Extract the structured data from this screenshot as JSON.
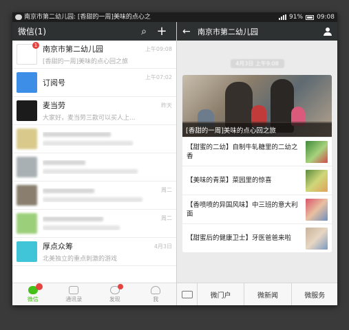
{
  "status_bar": {
    "notification": "南京市第二幼儿园: [香甜的一周]美味的点心之",
    "battery": "91%",
    "time": "09:08"
  },
  "chat_list": {
    "title": "微信(1)",
    "chats": [
      {
        "name": "南京市第二幼儿园",
        "preview": "[香甜的一周]美味的点心回之旅",
        "time": "上午09:08",
        "badge": "1",
        "avatar_color": "#ffffff"
      },
      {
        "name": "订阅号",
        "preview": "",
        "time": "上午07:02",
        "badge": "",
        "avatar_color": "#3d8ee6"
      },
      {
        "name": "麦当劳",
        "preview": "大家好，麦当劳三款可以买人上...",
        "time": "昨天",
        "badge": "",
        "avatar_color": "#1b1b1b"
      },
      {
        "name": "",
        "preview": "",
        "time": "",
        "badge": "",
        "avatar_color": "#d9c98a"
      },
      {
        "name": "",
        "preview": "",
        "time": "",
        "badge": "",
        "avatar_color": "#a9b0b3"
      },
      {
        "name": "",
        "preview": "",
        "time": "周二",
        "badge": "",
        "avatar_color": "#8a7f6e"
      },
      {
        "name": "",
        "preview": "",
        "time": "周二",
        "badge": "",
        "avatar_color": "#9ccf7a"
      },
      {
        "name": "厚点众筹",
        "preview": "北美独立的重点刺激的游戏",
        "time": "4月3日",
        "badge": "",
        "avatar_color": "#3fc4d8"
      }
    ],
    "tabs": [
      {
        "label": "微信",
        "badge": "1"
      },
      {
        "label": "通讯录",
        "badge": ""
      },
      {
        "label": "发现",
        "badge": "dot"
      },
      {
        "label": "我",
        "badge": ""
      }
    ]
  },
  "article_view": {
    "title": "南京市第二幼儿园",
    "date": "4月3日 上午9:08",
    "hero_caption": "[香甜的一周]美味的点心回之旅",
    "articles": [
      {
        "title": "【甜蜜的二幼】自制牛轧糖里的二幼之香"
      },
      {
        "title": "【美味的青菜】菜园里的惊喜"
      },
      {
        "title": "【香喷喷的异国风味】中三班的意大利面"
      },
      {
        "title": "【甜蜜后的健康卫士】牙医爸爸来啦"
      }
    ],
    "menu": [
      "微门户",
      "微新闻",
      "微服务"
    ]
  }
}
